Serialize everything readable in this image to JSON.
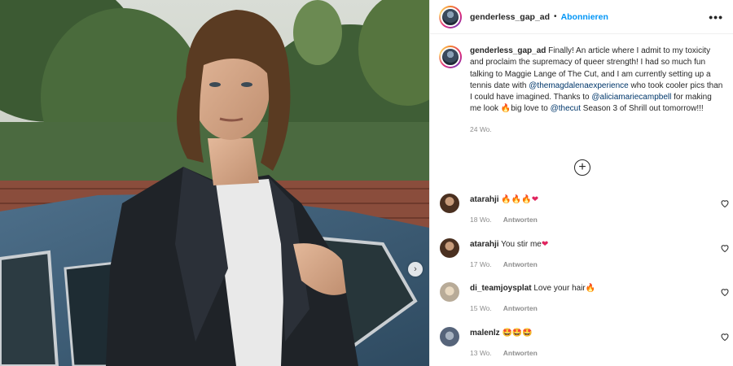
{
  "post": {
    "username": "genderless_gap_ad",
    "separator": "•",
    "follow_label": "Abonnieren",
    "more_icon": "more-horizontal-icon",
    "caption": {
      "username": "genderless_gap_ad",
      "part1": " Finally! An article where I admit to my toxicity and proclaim the supremacy of queer strength! I had so much fun talking to Maggie Lange of The Cut, and I am currently setting up a tennis date with ",
      "mention1": "@themagdalenaexperience",
      "part2": " who took cooler pics than I could have imagined. Thanks to ",
      "mention2": "@aliciamariecampbell",
      "part3": " for making me look ",
      "emoji1": "🔥",
      "part4": "big love to ",
      "mention3": "@thecut",
      "part5": " Season 3 of Shrill out tomorrow!!!"
    },
    "time": "24 Wo.",
    "load_more_label": "+"
  },
  "comments": [
    {
      "username": "atarahji",
      "text": " ",
      "emojis": "🔥🔥🔥",
      "emoji_heart": "❤",
      "time": "18 Wo.",
      "reply_label": "Antworten",
      "avatar_color": "#5a4030"
    },
    {
      "username": "atarahji",
      "text": " You stir me",
      "emojis": "",
      "emoji_heart": "❤",
      "time": "17 Wo.",
      "reply_label": "Antworten",
      "avatar_color": "#5a4030"
    },
    {
      "username": "di_teamjoysplat",
      "text": " Love your hair",
      "emojis": "🔥",
      "emoji_heart": "",
      "time": "15 Wo.",
      "reply_label": "Antworten",
      "avatar_color": "#c8bfb0"
    },
    {
      "username": "malenlz",
      "text": " ",
      "emojis": "🤩🤩🤩",
      "emoji_heart": "",
      "time": "13 Wo.",
      "reply_label": "Antworten",
      "avatar_color": "#7a8595"
    }
  ],
  "colors": {
    "link": "#00376b",
    "follow": "#0095f6",
    "muted": "#8e8e8e"
  }
}
